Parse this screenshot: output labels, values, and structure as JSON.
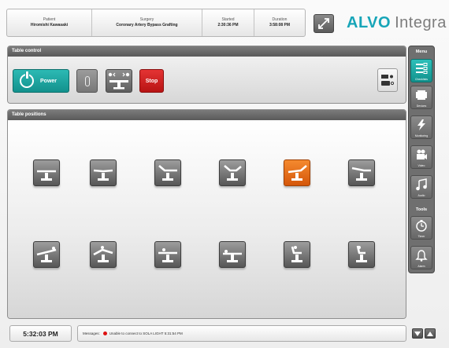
{
  "header": {
    "patient_label": "Patient",
    "patient_value": "Hiromishi Kawasaki",
    "surgery_label": "Surgery",
    "surgery_value": "Coronary Artery Bypass Grafting",
    "started_label": "Started",
    "started_value": "2:30:36 PM",
    "duration_label": "Duration",
    "duration_value": "3:58:08 PM",
    "logo_brand": "ALVO",
    "logo_product": "Integra"
  },
  "table_control": {
    "title": "Table control",
    "power_label": "Power",
    "stop_label": "Stop"
  },
  "table_positions": {
    "title": "Table positions",
    "positions": [
      {
        "icon": "flat-table-icon",
        "active": false
      },
      {
        "icon": "trendelenburg-table-icon",
        "active": false
      },
      {
        "icon": "back-raised-table-icon",
        "active": false
      },
      {
        "icon": "beach-chair-table-icon",
        "active": false
      },
      {
        "icon": "lateral-tilt-table-icon",
        "active": true
      },
      {
        "icon": "leg-lowered-table-icon",
        "active": false
      },
      {
        "icon": "reverse-tilt-table-icon",
        "active": false
      },
      {
        "icon": "flex-table-icon",
        "active": false
      },
      {
        "icon": "patient-prone-table-icon",
        "active": false
      },
      {
        "icon": "patient-supine-table-icon",
        "active": false
      },
      {
        "icon": "patient-seated-table-icon",
        "active": false
      },
      {
        "icon": "patient-upright-table-icon",
        "active": false
      }
    ]
  },
  "sidebar": {
    "menu_title": "Menu",
    "tools_title": "Tools",
    "menu_items": [
      {
        "label": "Checklists",
        "icon": "checklist-icon",
        "active": true
      },
      {
        "label": "Devices",
        "icon": "device-icon",
        "active": false
      },
      {
        "label": "Monitoring",
        "icon": "lightning-icon",
        "active": false
      },
      {
        "label": "Video",
        "icon": "video-camera-icon",
        "active": false
      },
      {
        "label": "Audio",
        "icon": "music-note-icon",
        "active": false
      }
    ],
    "tool_items": [
      {
        "label": "Timer",
        "icon": "timer-icon",
        "active": false
      },
      {
        "label": "Alarm",
        "icon": "bell-icon",
        "active": false
      }
    ]
  },
  "footer": {
    "clock": "5:32:03 PM",
    "messages_label": "Messages:",
    "message_text": "Unable to connect to SOLA LIGHT 5:31:54 PM"
  },
  "colors": {
    "accent_teal": "#17a5b8",
    "active_orange": "#e36b19",
    "stop_red": "#d11f1f"
  }
}
